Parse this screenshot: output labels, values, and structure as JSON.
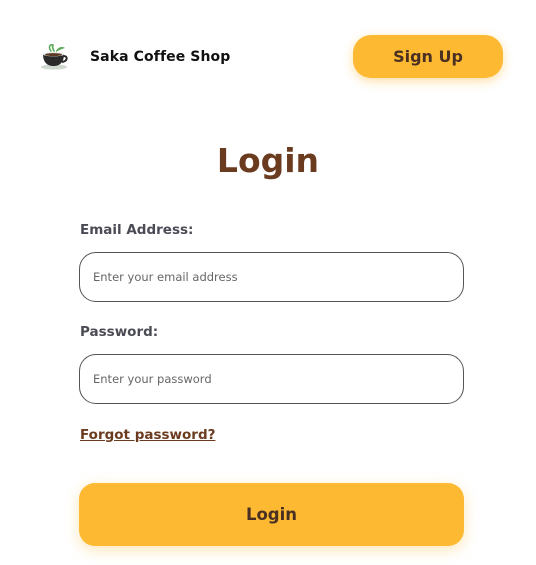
{
  "header": {
    "brand_name": "Saka Coffee Shop",
    "logo_icon": "coffee-cup-icon",
    "signup_label": "Sign Up"
  },
  "main": {
    "title": "Login",
    "email": {
      "label": "Email Address:",
      "placeholder": "Enter your email address",
      "value": ""
    },
    "password": {
      "label": "Password:",
      "placeholder": "Enter your password",
      "value": ""
    },
    "forgot_link": "Forgot password?",
    "login_label": "Login"
  },
  "colors": {
    "accent": "#fdb932",
    "title_brown": "#6b3b1f",
    "button_text": "#4a3022",
    "logo_green": "#5daa5a"
  }
}
